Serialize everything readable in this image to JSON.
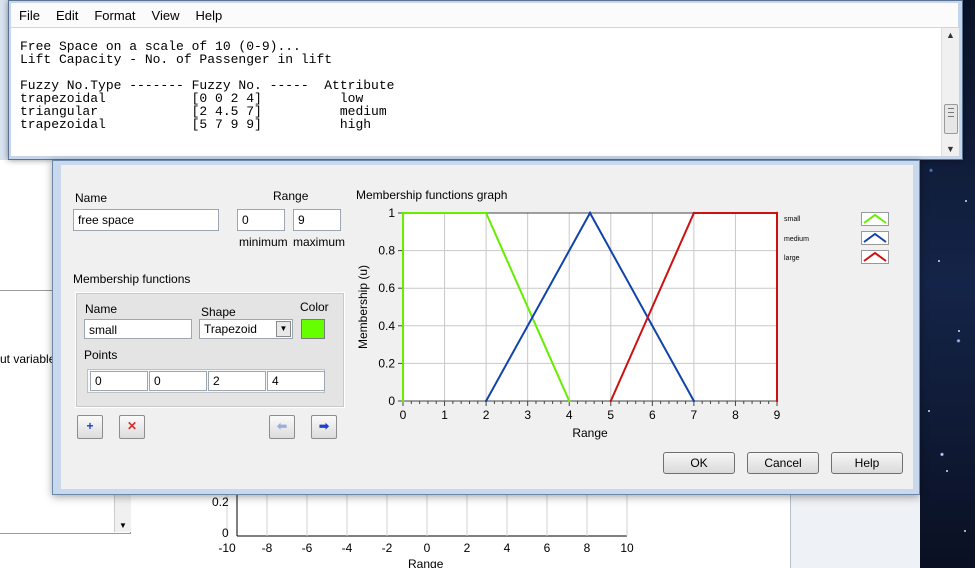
{
  "notepad": {
    "menu": [
      "File",
      "Edit",
      "Format",
      "View",
      "Help"
    ],
    "lines": [
      "Free Space on a scale of 10 (0-9)...",
      "Lift Capacity - No. of Passenger in lift",
      "",
      "Fuzzy No.Type ------- Fuzzy No. -----  Attribute",
      "trapezoidal           [0 0 2 4]          low",
      "triangular            [2 4.5 7]          medium",
      "trapezoidal           [5 7 9 9]          high"
    ]
  },
  "dialog": {
    "name_label": "Name",
    "name_value": "free space",
    "range_label": "Range",
    "range_min": "0",
    "range_max": "9",
    "min_label": "minimum",
    "max_label": "maximum",
    "mf_label": "Membership functions",
    "mf_name_label": "Name",
    "mf_name_value": "small",
    "shape_label": "Shape",
    "shape_value": "Trapezoid",
    "color_label": "Color",
    "color_value": "#66ff00",
    "points_label": "Points",
    "points": [
      "0",
      "0",
      "2",
      "4"
    ],
    "buttons": {
      "ok": "OK",
      "cancel": "Cancel",
      "help": "Help"
    }
  },
  "chart_data": {
    "type": "line",
    "title": "Membership functions graph",
    "xlabel": "Range",
    "ylabel": "Membership (u)",
    "xlim": [
      0,
      9
    ],
    "ylim": [
      0,
      1
    ],
    "x_ticks": [
      "0",
      "1",
      "2",
      "3",
      "4",
      "5",
      "6",
      "7",
      "8",
      "9"
    ],
    "y_ticks": [
      "0",
      "0.2",
      "0.4",
      "0.6",
      "0.8",
      "1"
    ],
    "grid": true,
    "legend_position": "right",
    "series": [
      {
        "name": "small",
        "color": "#66ee00",
        "x": [
          0,
          0,
          2,
          4
        ],
        "y": [
          0,
          1,
          1,
          0
        ]
      },
      {
        "name": "medium",
        "color": "#1144aa",
        "x": [
          2,
          4.5,
          7
        ],
        "y": [
          0,
          1,
          0
        ]
      },
      {
        "name": "large",
        "color": "#cc1111",
        "x": [
          5,
          7,
          9,
          9
        ],
        "y": [
          0,
          1,
          1,
          0
        ]
      }
    ]
  },
  "background": {
    "left_label": "ut variable",
    "y_ticks": [
      "0.2",
      "0"
    ],
    "x_ticks": [
      "-10",
      "-8",
      "-6",
      "-4",
      "-2",
      "0",
      "2",
      "4",
      "6",
      "8",
      "10"
    ],
    "xlabel": "Range"
  }
}
